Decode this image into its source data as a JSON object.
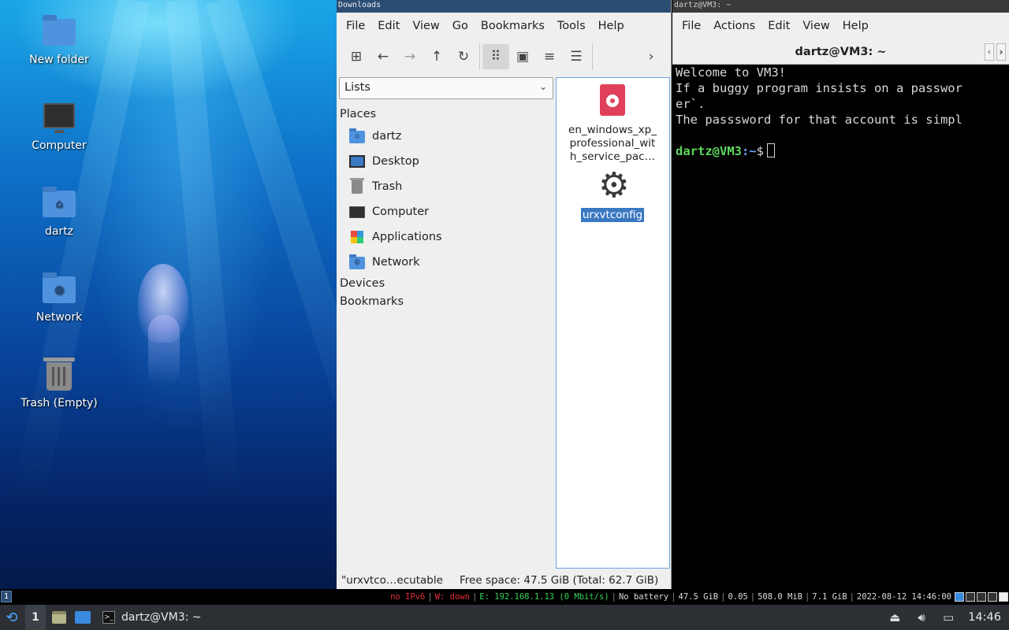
{
  "desktop": {
    "icons": [
      {
        "label": "New folder"
      },
      {
        "label": "Computer"
      },
      {
        "label": "dartz"
      },
      {
        "label": "Network"
      },
      {
        "label": "Trash (Empty)"
      }
    ]
  },
  "file_manager": {
    "window_title": "Downloads",
    "menu": [
      "File",
      "Edit",
      "View",
      "Go",
      "Bookmarks",
      "Tools",
      "Help"
    ],
    "side_mode": "Lists",
    "sections": {
      "places": "Places",
      "devices": "Devices",
      "bookmarks": "Bookmarks"
    },
    "places": [
      "dartz",
      "Desktop",
      "Trash",
      "Computer",
      "Applications",
      "Network"
    ],
    "files": [
      {
        "name_lines": [
          "en_windows_xp_",
          "professional_wit",
          "h_service_pac…"
        ]
      },
      {
        "name": "urxvtconfig"
      }
    ],
    "status_left": "\"urxvtco…ecutable",
    "status_right": "Free space: 47.5 GiB (Total: 62.7 GiB)"
  },
  "terminal": {
    "window_title": "dartz@VM3: ~",
    "menu": [
      "File",
      "Actions",
      "Edit",
      "View",
      "Help"
    ],
    "tab_title": "dartz@VM3: ~",
    "lines": [
      "Welcome to VM3!",
      "If a buggy program insists on a passwor",
      "er`.",
      "The passsword for that account is simpl"
    ],
    "prompt_user": "dartz@VM3",
    "prompt_path": ":~",
    "prompt_symbol": "$"
  },
  "status_strip": {
    "workspace": "1",
    "ipv6": "no IPv6",
    "wireless": "W: down",
    "ethernet": "E: 192.168.1.13 (0 Mbit/s)",
    "battery": "No battery",
    "disk": "47.5 GiB",
    "load": "0.05",
    "memory": "508.0 MiB",
    "swap": "7.1 GiB",
    "datetime": "2022-08-12 14:46:00"
  },
  "panel": {
    "pager": "1",
    "task_label": "dartz@VM3: ~",
    "clock": "14:46"
  },
  "colors": {
    "selection": "#3a78c2",
    "prompt_user": "#5fd75f",
    "prompt_path": "#6fa8ff"
  }
}
